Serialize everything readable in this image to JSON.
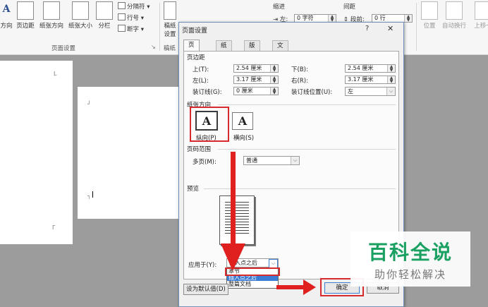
{
  "ribbon": {
    "buttons": [
      {
        "label": "方向"
      },
      {
        "label": "页边距"
      },
      {
        "label": "纸张方向"
      },
      {
        "label": "纸张大小"
      },
      {
        "label": "分栏"
      }
    ],
    "small_items": [
      {
        "label": "分隔符 ▾"
      },
      {
        "label": "行号 ▾"
      },
      {
        "label": "断字 ▾"
      }
    ],
    "group_label_page_setup": "页面设置",
    "group_label_draft": "稿纸",
    "draft_button_line1": "稿纸",
    "draft_button_line2": "设置",
    "indent": {
      "title": "缩进",
      "left_label": "左:",
      "left_value": "0 字符"
    },
    "spacing": {
      "title": "间距",
      "before_label": "段前:",
      "before_value": "0 行"
    },
    "right_items": [
      {
        "label": "位置"
      },
      {
        "label": "自动换行"
      },
      {
        "label": "上移一"
      }
    ]
  },
  "dialog": {
    "title": "页面设置",
    "help": "?",
    "close": "✕",
    "tabs": [
      "页边距",
      "纸张",
      "版式",
      "文档网格"
    ],
    "margins": {
      "section": "页边距",
      "top_label": "上(T):",
      "top_value": "2.54 厘米",
      "bottom_label": "下(B):",
      "bottom_value": "2.54 厘米",
      "left_label": "左(L):",
      "left_value": "3.17 厘米",
      "right_label": "右(R):",
      "right_value": "3.17 厘米",
      "gutter_label": "装订线(G):",
      "gutter_value": "0 厘米",
      "gutter_pos_label": "装订线位置(U):",
      "gutter_pos_value": "左"
    },
    "orientation": {
      "section": "纸张方向",
      "portrait_label": "纵向(P)",
      "landscape_label": "横向(S)",
      "glyph": "A"
    },
    "pages": {
      "section": "页码范围",
      "multi_label": "多页(M):",
      "multi_value": "普通"
    },
    "preview": {
      "section": "预览"
    },
    "apply": {
      "label": "应用于(Y):",
      "value": "插入点之后",
      "options": [
        "本节",
        "插入点之后",
        "整篇文档"
      ]
    },
    "default_button": "设为默认值(D)",
    "ok_button": "确定",
    "cancel_button": "取消"
  },
  "watermark": {
    "line1": "百科全说",
    "line2": "助你轻松解决"
  },
  "colors": {
    "highlight": "#d82a2a",
    "watermark_green": "#1aa061",
    "dialog_border": "#6d8fb8"
  }
}
